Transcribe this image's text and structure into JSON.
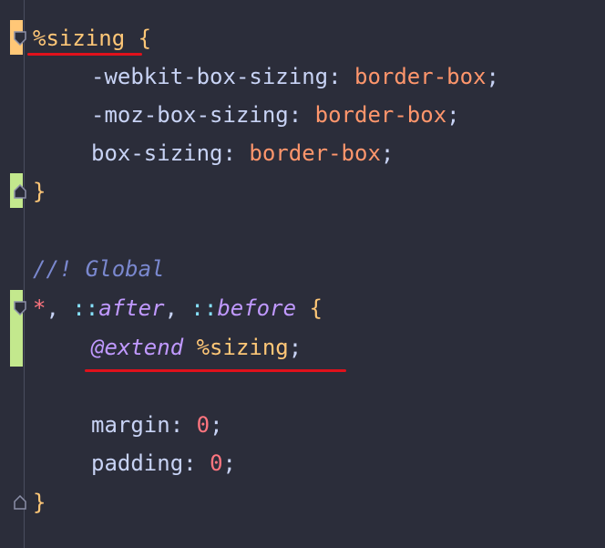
{
  "code": {
    "l1": {
      "selector": "%sizing",
      "brace": " {"
    },
    "l2": {
      "prop": "-webkit-box-sizing",
      "colon": ": ",
      "value": "border-box",
      "semi": ";"
    },
    "l3": {
      "prop": "-moz-box-sizing",
      "colon": ": ",
      "value": "border-box",
      "semi": ";"
    },
    "l4": {
      "prop": "box-sizing",
      "colon": ": ",
      "value": "border-box",
      "semi": ";"
    },
    "l5": {
      "brace": "}"
    },
    "l7": {
      "comment": "//! Global"
    },
    "l8": {
      "star": "*",
      "sep1": ", ",
      "c1": "::",
      "after": "after",
      "sep2": ", ",
      "c2": "::",
      "before": "before",
      "brace": " {"
    },
    "l9": {
      "at": "@extend",
      "space": " ",
      "placeholder": "%sizing",
      "semi": ";"
    },
    "l11": {
      "prop": "margin",
      "colon": ": ",
      "value": "0",
      "semi": ";"
    },
    "l12": {
      "prop": "padding",
      "colon": ": ",
      "value": "0",
      "semi": ";"
    },
    "l13": {
      "brace": "}"
    }
  },
  "colors": {
    "background": "#2b2d3a",
    "modified_marker": "#ffc777",
    "added_marker": "#c3e88d",
    "underline": "#e0111b"
  }
}
